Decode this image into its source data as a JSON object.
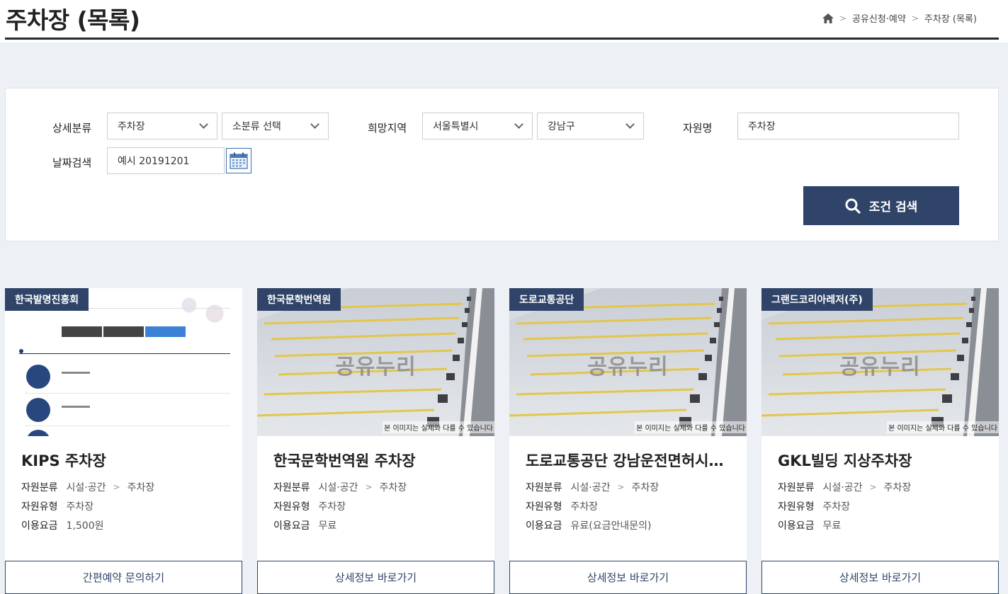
{
  "header": {
    "title": "주차장 (목록)",
    "breadcrumb": [
      "공유신청·예약",
      "주차장 (목록)"
    ]
  },
  "search": {
    "category_label": "상세분류",
    "category_value": "주차장",
    "subcategory_value": "소분류 선택",
    "region_label": "희망지역",
    "region_city": "서울특별시",
    "region_district": "강남구",
    "name_label": "자원명",
    "name_value": "주차장",
    "date_label": "날짜검색",
    "date_placeholder": "예시 20191201",
    "search_button": "조건 검색"
  },
  "card_labels": {
    "category": "자원분류",
    "type": "자원유형",
    "fee": "이용요금",
    "image_note": "본 이미지는 실제와 다를 수 있습니다",
    "watermark": "공유누리"
  },
  "cards": [
    {
      "badge": "한국발명진흥회",
      "name": "KIPS 주차장",
      "category": "시설·공간",
      "subcategory": "주차장",
      "type": "주차장",
      "fee": "1,500원",
      "button": "간편예약 문의하기"
    },
    {
      "badge": "한국문학번역원",
      "name": "한국문학번역원 주차장",
      "category": "시설·공간",
      "subcategory": "주차장",
      "type": "주차장",
      "fee": "무료",
      "button": "상세정보 바로가기"
    },
    {
      "badge": "도로교통공단",
      "name": "도로교통공단 강남운전면허시…",
      "category": "시설·공간",
      "subcategory": "주차장",
      "type": "주차장",
      "fee": "유료(요금안내문의)",
      "button": "상세정보 바로가기"
    },
    {
      "badge": "그랜드코리아레저(주)",
      "name": "GKL빌딩 지상주차장",
      "category": "시설·공간",
      "subcategory": "주차장",
      "type": "주차장",
      "fee": "무료",
      "button": "상세정보 바로가기"
    }
  ]
}
